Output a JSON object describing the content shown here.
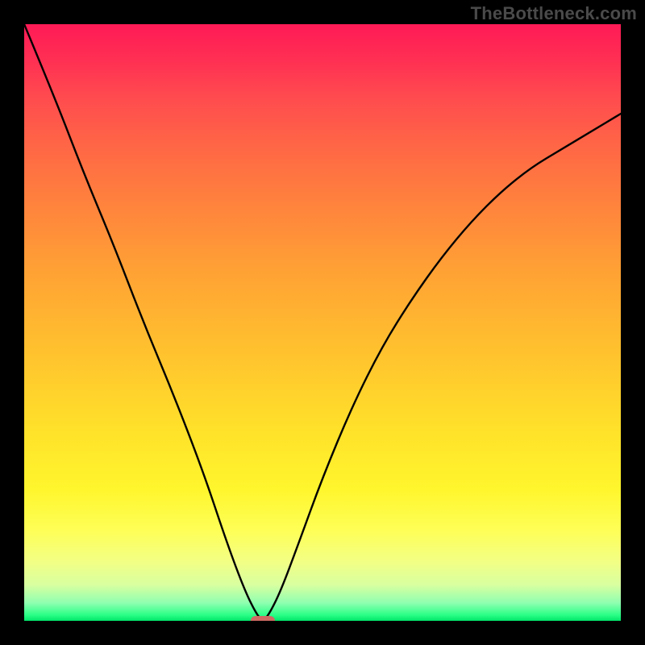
{
  "watermark": "TheBottleneck.com",
  "chart_data": {
    "type": "line",
    "title": "",
    "xlabel": "",
    "ylabel": "",
    "xlim": [
      0,
      100
    ],
    "ylim": [
      0,
      100
    ],
    "grid": false,
    "legend": false,
    "series": [
      {
        "name": "bottleneck-curve",
        "x": [
          0,
          5,
          10,
          15,
          20,
          25,
          30,
          34,
          37,
          39,
          40,
          41,
          43,
          46,
          50,
          55,
          60,
          65,
          70,
          75,
          80,
          85,
          90,
          95,
          100
        ],
        "values": [
          100,
          88,
          75,
          63,
          50,
          38,
          25,
          13,
          5,
          1,
          0,
          1,
          5,
          13,
          24,
          36,
          46,
          54,
          61,
          67,
          72,
          76,
          79,
          82,
          85
        ]
      }
    ],
    "annotations": [
      {
        "name": "optimal-marker",
        "x": 40,
        "y": 0
      }
    ],
    "background_gradient_stops": [
      {
        "pos": 0,
        "color": "#ff1a56"
      },
      {
        "pos": 42,
        "color": "#ffa334"
      },
      {
        "pos": 78,
        "color": "#fff62d"
      },
      {
        "pos": 100,
        "color": "#00e56a"
      }
    ]
  }
}
